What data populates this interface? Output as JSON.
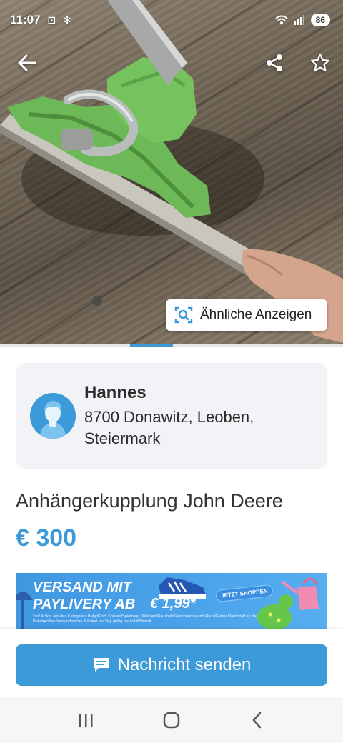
{
  "status_bar": {
    "time": "11:07",
    "battery": "86"
  },
  "photo_actions": {
    "back_icon": "arrow-left-icon",
    "share_icon": "share-icon",
    "favorite_icon": "star-outline-icon"
  },
  "similar_ads": {
    "label": "Ähnliche Anzeigen",
    "icon": "image-search-icon"
  },
  "seller": {
    "name": "Hannes",
    "location": "8700 Donawitz, Leoben, Steiermark"
  },
  "listing": {
    "title": "Anhängerkupplung John Deere",
    "price": "€ 300"
  },
  "banner": {
    "line1": "VERSAND MIT",
    "line2": "PAYLIVERY AB",
    "price": "€ 1,99*",
    "cta": "JETZT SHOPPEN",
    "fineprint": "*auf Artikel aus den Kategorien Baby/Kind, Spielen/Spielzeug, Wohnen/Haushalt/Gastronomie und Haus/Garten/Werkstatt für die Paketgrößen Versandtasche & Paket bis 3kg, gültig bis auf Widerruf"
  },
  "send_button": {
    "label": "Nachricht senden",
    "icon": "message-icon"
  },
  "colors": {
    "accent": "#3d9ad8",
    "card_bg": "#f1f3f6"
  }
}
